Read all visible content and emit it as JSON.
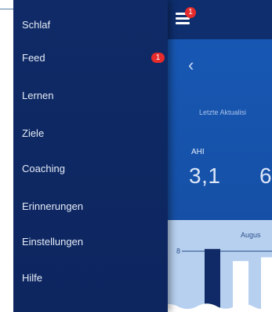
{
  "menu": {
    "items": [
      {
        "label": "Schlaf"
      },
      {
        "label": "Feed",
        "badge": "1"
      },
      {
        "label": "Lernen"
      },
      {
        "label": "Ziele"
      },
      {
        "label": "Coaching"
      },
      {
        "label": "Erinnerungen"
      },
      {
        "label": "Einstellungen"
      },
      {
        "label": "Hilfe"
      }
    ]
  },
  "app": {
    "menu_badge": "1",
    "back_icon": "chevron-left-icon",
    "last_update_text": "Letzte Aktualisi",
    "ahi_label": "AHI",
    "ahi_value": "3,1",
    "second_value_partial": "6",
    "chart": {
      "month_label": "Augus",
      "y_tick": "8",
      "bar_colors": [
        "#0f2a66",
        "#ffffff",
        "#ffffff"
      ]
    }
  },
  "colors": {
    "menu_bg": "#0f2a66",
    "app_bg": "#1757b3",
    "badge": "#e52b2b",
    "chart_bg": "#b7d0ef"
  },
  "chart_data": {
    "type": "bar",
    "title": "Augus",
    "categories": [
      "",
      "",
      ""
    ],
    "values": [
      8.3,
      6.7,
      7.2
    ],
    "ylim": [
      0,
      9
    ],
    "yticks": [
      "8"
    ]
  }
}
